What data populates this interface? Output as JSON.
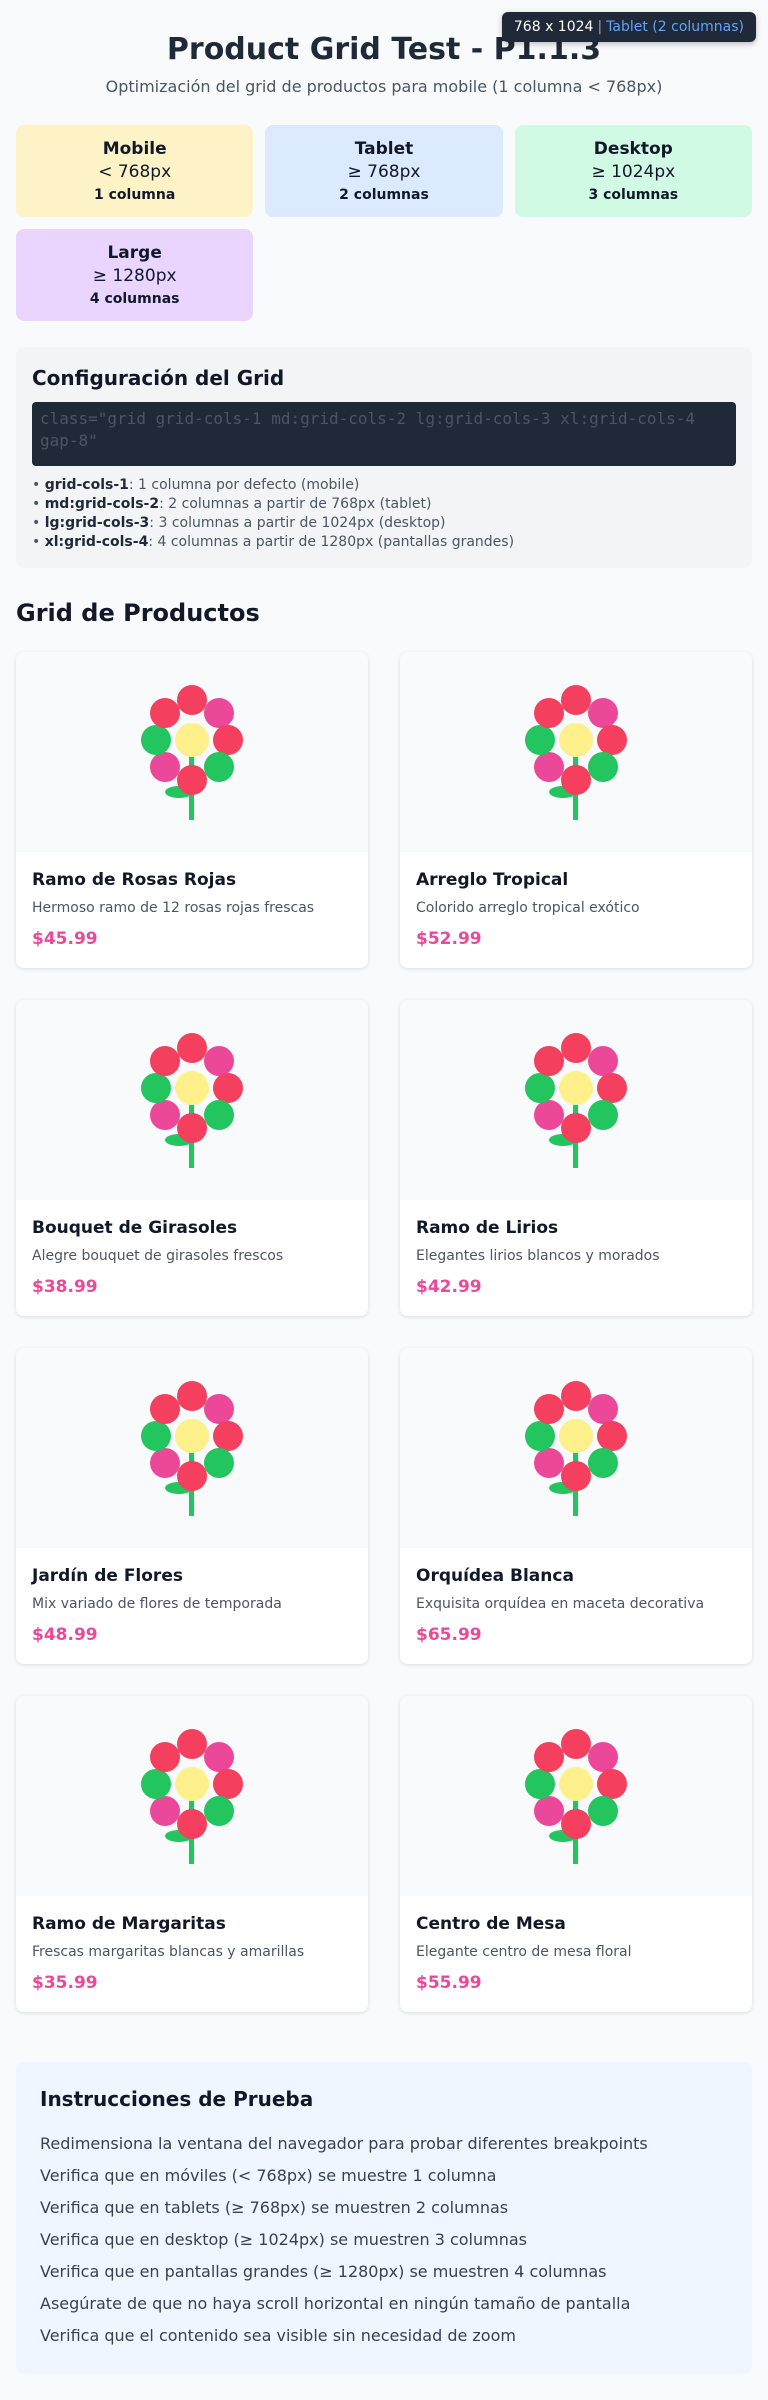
{
  "badge": {
    "size": "768 x 1024",
    "separator": "|",
    "mode": "Tablet (2 columnas)"
  },
  "header": {
    "title": "Product Grid Test - P1.1.3",
    "subtitle": "Optimización del grid de productos para mobile (1 columna < 768px)"
  },
  "breakpoints": [
    {
      "name": "Mobile",
      "range": "< 768px",
      "cols": "1 columna",
      "color": "#fef3c7"
    },
    {
      "name": "Tablet",
      "range": "≥ 768px",
      "cols": "2 columnas",
      "color": "#dbeafe"
    },
    {
      "name": "Desktop",
      "range": "≥ 1024px",
      "cols": "3 columnas",
      "color": "#d1fae5"
    },
    {
      "name": "Large",
      "range": "≥ 1280px",
      "cols": "4 columnas",
      "color": "#e9d5ff"
    }
  ],
  "config": {
    "title": "Configuración del Grid",
    "code": "class=\"grid grid-cols-1 md:grid-cols-2 lg:grid-cols-3 xl:grid-cols-4 gap-8\"",
    "notes": [
      {
        "key": "grid-cols-1",
        "text": ": 1 columna por defecto (mobile)"
      },
      {
        "key": "md:grid-cols-2",
        "text": ": 2 columnas a partir de 768px (tablet)"
      },
      {
        "key": "lg:grid-cols-3",
        "text": ": 3 columnas a partir de 1024px (desktop)"
      },
      {
        "key": "xl:grid-cols-4",
        "text": ": 4 columnas a partir de 1280px (pantallas grandes)"
      }
    ]
  },
  "products_section": {
    "title": "Grid de Productos",
    "items": [
      {
        "name": "Ramo de Rosas Rojas",
        "desc": "Hermoso ramo de 12 rosas rojas frescas",
        "price": "$45.99",
        "icon": "flower-icon"
      },
      {
        "name": "Arreglo Tropical",
        "desc": "Colorido arreglo tropical exótico",
        "price": "$52.99",
        "icon": "flower-icon"
      },
      {
        "name": "Bouquet de Girasoles",
        "desc": "Alegre bouquet de girasoles frescos",
        "price": "$38.99",
        "icon": "flower-icon"
      },
      {
        "name": "Ramo de Lirios",
        "desc": "Elegantes lirios blancos y morados",
        "price": "$42.99",
        "icon": "flower-icon"
      },
      {
        "name": "Jardín de Flores",
        "desc": "Mix variado de flores de temporada",
        "price": "$48.99",
        "icon": "flower-icon"
      },
      {
        "name": "Orquídea Blanca",
        "desc": "Exquisita orquídea en maceta decorativa",
        "price": "$65.99",
        "icon": "flower-icon"
      },
      {
        "name": "Ramo de Margaritas",
        "desc": "Frescas margaritas blancas y amarillas",
        "price": "$35.99",
        "icon": "flower-icon"
      },
      {
        "name": "Centro de Mesa",
        "desc": "Elegante centro de mesa floral",
        "price": "$55.99",
        "icon": "flower-icon"
      }
    ]
  },
  "instructions": {
    "title": "Instrucciones de Prueba",
    "items": [
      "Redimensiona la ventana del navegador para probar diferentes breakpoints",
      "Verifica que en móviles (< 768px) se muestre 1 columna",
      "Verifica que en tablets (≥ 768px) se muestren 2 columnas",
      "Verifica que en desktop (≥ 1024px) se muestren 3 columnas",
      "Verifica que en pantallas grandes (≥ 1280px) se muestren 4 columnas",
      "Asegúrate de que no haya scroll horizontal en ningún tamaño de pantalla",
      "Verifica que el contenido sea visible sin necesidad de zoom"
    ]
  },
  "colors": {
    "accent_price": "#ec4899",
    "petal_red": "#f43f5e",
    "petal_pink": "#ec4899",
    "petal_green": "#22c55e",
    "center_yellow": "#fef08a",
    "stem": "#22c55e"
  }
}
